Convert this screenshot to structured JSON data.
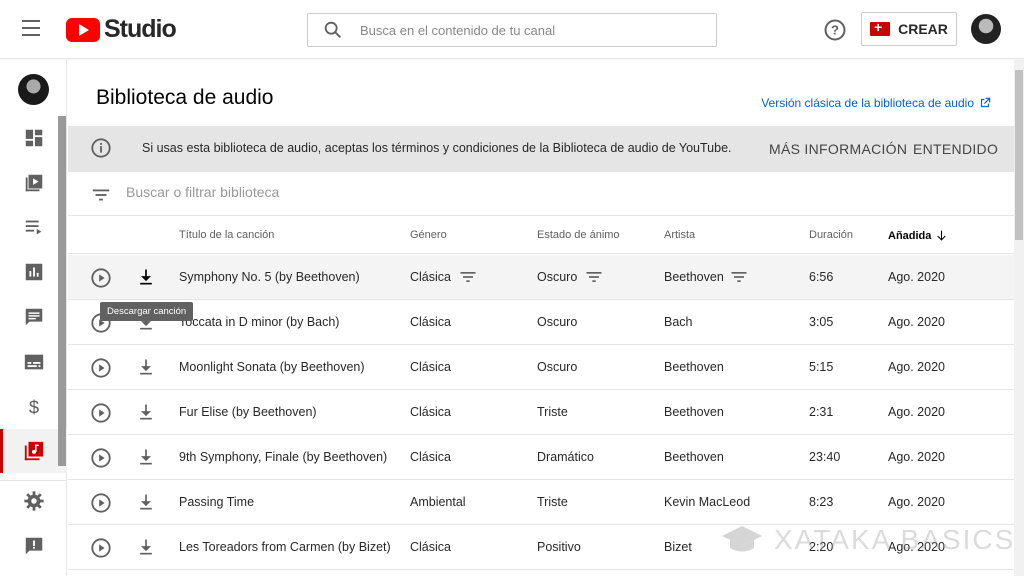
{
  "app": {
    "logo_text": "Studio"
  },
  "topbar": {
    "search_placeholder": "Busca en el contenido de tu canal",
    "create_label": "CREAR"
  },
  "sidebar": {
    "items": [
      {
        "icon": "dashboard-icon"
      },
      {
        "icon": "content-icon"
      },
      {
        "icon": "playlists-icon"
      },
      {
        "icon": "analytics-icon"
      },
      {
        "icon": "comments-icon"
      },
      {
        "icon": "subtitles-icon"
      },
      {
        "icon": "monetization-icon"
      },
      {
        "icon": "audio-library-icon",
        "active": true
      },
      {
        "icon": "settings-icon"
      },
      {
        "icon": "feedback-icon"
      }
    ]
  },
  "page": {
    "title": "Biblioteca de audio",
    "classic_link": "Versión clásica de la biblioteca de audio"
  },
  "banner": {
    "text": "Si usas esta biblioteca de audio, aceptas los términos y condiciones de la Biblioteca de audio de YouTube.",
    "more_label": "MÁS INFORMACIÓN",
    "ok_label": "ENTENDIDO"
  },
  "filter": {
    "placeholder": "Buscar o filtrar biblioteca"
  },
  "table": {
    "headers": {
      "title": "Título de la canción",
      "genre": "Género",
      "mood": "Estado de ánimo",
      "artist": "Artista",
      "duration": "Duración",
      "added": "Añadida"
    },
    "rows": [
      {
        "title": "Symphony No. 5 (by Beethoven)",
        "genre": "Clásica",
        "mood": "Oscuro",
        "artist": "Beethoven",
        "duration": "6:56",
        "added": "Ago. 2020"
      },
      {
        "title": "Toccata in D minor (by Bach)",
        "genre": "Clásica",
        "mood": "Oscuro",
        "artist": "Bach",
        "duration": "3:05",
        "added": "Ago. 2020"
      },
      {
        "title": "Moonlight Sonata (by Beethoven)",
        "genre": "Clásica",
        "mood": "Oscuro",
        "artist": "Beethoven",
        "duration": "5:15",
        "added": "Ago. 2020"
      },
      {
        "title": "Fur Elise (by Beethoven)",
        "genre": "Clásica",
        "mood": "Triste",
        "artist": "Beethoven",
        "duration": "2:31",
        "added": "Ago. 2020"
      },
      {
        "title": "9th Symphony, Finale (by Beethoven)",
        "genre": "Clásica",
        "mood": "Dramático",
        "artist": "Beethoven",
        "duration": "23:40",
        "added": "Ago. 2020"
      },
      {
        "title": "Passing Time",
        "genre": "Ambiental",
        "mood": "Triste",
        "artist": "Kevin MacLeod",
        "duration": "8:23",
        "added": "Ago. 2020"
      },
      {
        "title": "Les Toreadors from Carmen (by Bizet)",
        "genre": "Clásica",
        "mood": "Positivo",
        "artist": "Bizet",
        "duration": "2:20",
        "added": "Ago. 2020"
      }
    ]
  },
  "tooltip": "Descargar canción",
  "watermark": "XATAKA BASICS",
  "colors": {
    "brand_red": "#ff0000",
    "accent_red": "#cc0000",
    "link_blue": "#065fd4"
  }
}
